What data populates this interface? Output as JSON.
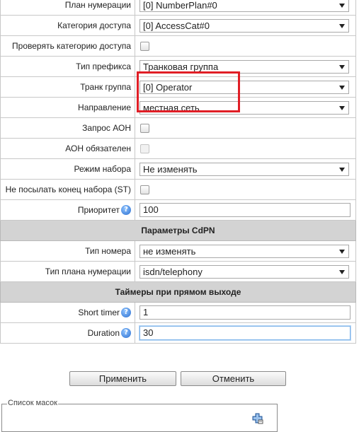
{
  "rows": {
    "numbering_plan": {
      "label": "План нумерации",
      "value": "[0] NumberPlan#0"
    },
    "access_category": {
      "label": "Категория доступа",
      "value": "[0] AccessCat#0"
    },
    "check_access_category": {
      "label": "Проверять категорию доступа"
    },
    "prefix_type": {
      "label": "Тип префикса",
      "value": "Транковая группа"
    },
    "trunk_group": {
      "label": "Транк группа",
      "value": "[0] Operator"
    },
    "direction": {
      "label": "Направление",
      "value": "местная сеть"
    },
    "aon_request": {
      "label": "Запрос АОН"
    },
    "aon_required": {
      "label": "АОН обязателен"
    },
    "dial_mode": {
      "label": "Режим набора",
      "value": "Не изменять"
    },
    "no_send_st": {
      "label": "Не посылать конец набора (ST)"
    },
    "priority": {
      "label": "Приоритет",
      "value": "100"
    }
  },
  "cdpn_section": {
    "title": "Параметры CdPN",
    "number_type": {
      "label": "Тип номера",
      "value": "не изменять"
    },
    "numbering_plan_type": {
      "label": "Тип плана нумерации",
      "value": "isdn/telephony"
    }
  },
  "timers_section": {
    "title": "Таймеры при прямом выходе",
    "short_timer": {
      "label": "Short timer",
      "value": "1"
    },
    "duration": {
      "label": "Duration",
      "value": "30"
    }
  },
  "buttons": {
    "apply": "Применить",
    "cancel": "Отменить"
  },
  "masks": {
    "legend": "Список масок"
  },
  "help_glyph": "?",
  "colors": {
    "highlight": "#e01e26",
    "section_bg": "#d3d3d3"
  },
  "icons": [
    "help-icon",
    "dropdown-arrow-icon",
    "add-mask-icon"
  ]
}
